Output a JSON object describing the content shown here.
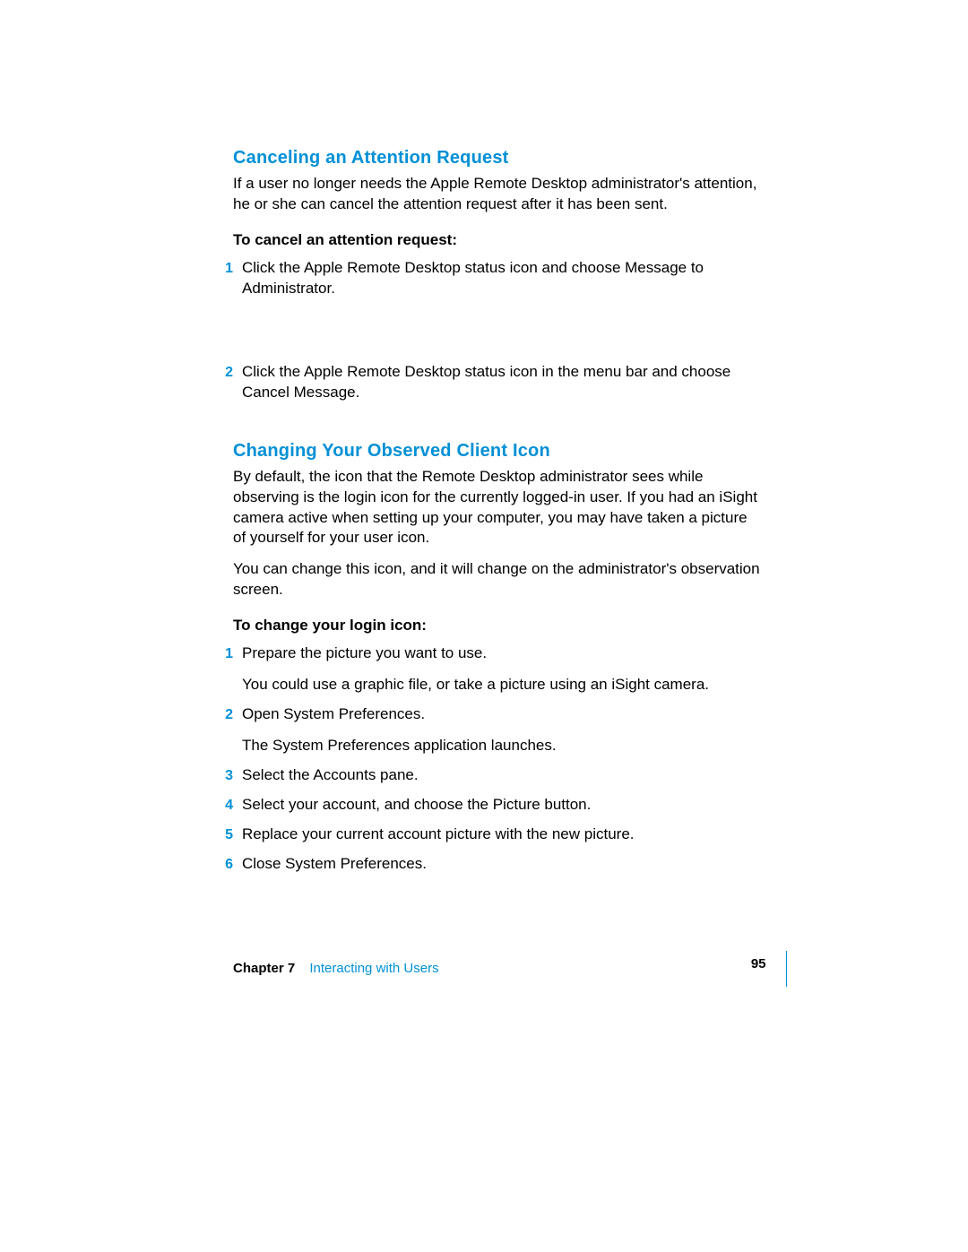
{
  "section1": {
    "heading": "Canceling an Attention Request",
    "intro": "If a user no longer needs the Apple Remote Desktop administrator's attention, he or she can cancel the attention request after it has been sent.",
    "subheading": "To cancel an attention request:",
    "steps": [
      {
        "num": "1",
        "text": "Click the Apple Remote Desktop status icon and choose Message to Administrator."
      },
      {
        "num": "2",
        "text": "Click the Apple Remote Desktop status icon in the menu bar and choose Cancel Message."
      }
    ]
  },
  "section2": {
    "heading": "Changing Your Observed Client Icon",
    "intro1": "By default, the icon that the Remote Desktop administrator sees while observing is the login icon for the currently logged-in user. If you had an iSight camera active when setting up your computer, you may have taken a picture of yourself for your user icon.",
    "intro2": "You can change this icon, and it will change on the administrator's observation screen.",
    "subheading": "To change your login icon:",
    "steps": [
      {
        "num": "1",
        "text": "Prepare the picture you want to use.",
        "sub": "You could use a graphic file, or take a picture using an iSight camera."
      },
      {
        "num": "2",
        "text": "Open System Preferences.",
        "sub": "The System Preferences application launches."
      },
      {
        "num": "3",
        "text": "Select the Accounts pane."
      },
      {
        "num": "4",
        "text": "Select your account, and choose the Picture button."
      },
      {
        "num": "5",
        "text": "Replace your current account picture with the new picture."
      },
      {
        "num": "6",
        "text": "Close System Preferences."
      }
    ]
  },
  "footer": {
    "chapter_label": "Chapter 7",
    "chapter_title": "Interacting with Users",
    "page_number": "95"
  }
}
